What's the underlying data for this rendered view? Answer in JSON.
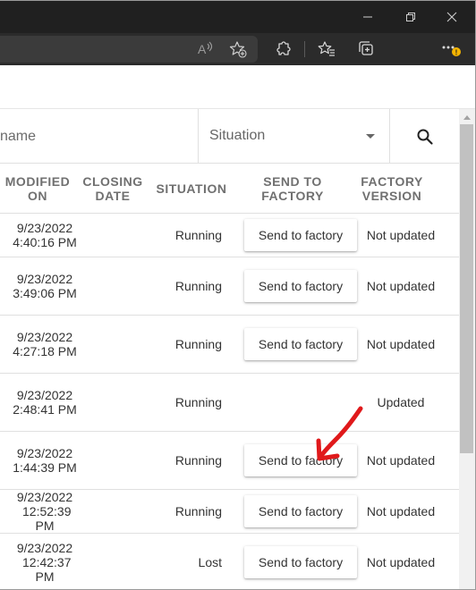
{
  "window": {
    "minimize_icon": "minimize-icon",
    "restore_icon": "restore-icon",
    "close_icon": "close-icon"
  },
  "toolbar": {
    "icons": [
      "read-aloud-icon",
      "add-favorite-icon",
      "extensions-icon",
      "favorites-icon",
      "collections-icon",
      "more-icon"
    ],
    "badge_color": "#f5b400"
  },
  "filters": {
    "name_placeholder": "name",
    "situation_label": "Situation",
    "search_icon": "search-icon"
  },
  "table": {
    "headers": {
      "modified_on": "MODIFIED ON",
      "closing_date": "CLOSING DATE",
      "situation": "SITUATION",
      "send_to_factory": "SEND TO FACTORY",
      "factory_version": "FACTORY VERSION"
    },
    "rows": [
      {
        "modified_date": "9/23/2022",
        "modified_time": "4:40:16 PM",
        "closing_date": "",
        "situation": "Running",
        "button": "Send to factory",
        "factory_version": "Not updated"
      },
      {
        "modified_date": "9/23/2022",
        "modified_time": "3:49:06 PM",
        "closing_date": "",
        "situation": "Running",
        "button": "Send to factory",
        "factory_version": "Not updated"
      },
      {
        "modified_date": "9/23/2022",
        "modified_time": "4:27:18 PM",
        "closing_date": "",
        "situation": "Running",
        "button": "Send to factory",
        "factory_version": "Not updated"
      },
      {
        "modified_date": "9/23/2022",
        "modified_time": "2:48:41 PM",
        "closing_date": "",
        "situation": "Running",
        "button": "",
        "factory_version": "Updated"
      },
      {
        "modified_date": "9/23/2022",
        "modified_time": "1:44:39 PM",
        "closing_date": "",
        "situation": "Running",
        "button": "Send to factory",
        "factory_version": "Not updated"
      },
      {
        "modified_date": "9/23/2022",
        "modified_time": "12:52:39 PM",
        "closing_date": "",
        "situation": "Running",
        "button": "Send to factory",
        "factory_version": "Not updated"
      },
      {
        "modified_date": "9/23/2022",
        "modified_time": "12:42:37 PM",
        "closing_date": "",
        "situation": "Lost",
        "button": "Send to factory",
        "factory_version": "Not updated"
      }
    ]
  },
  "annotation": {
    "arrow_color": "#e0191b"
  }
}
